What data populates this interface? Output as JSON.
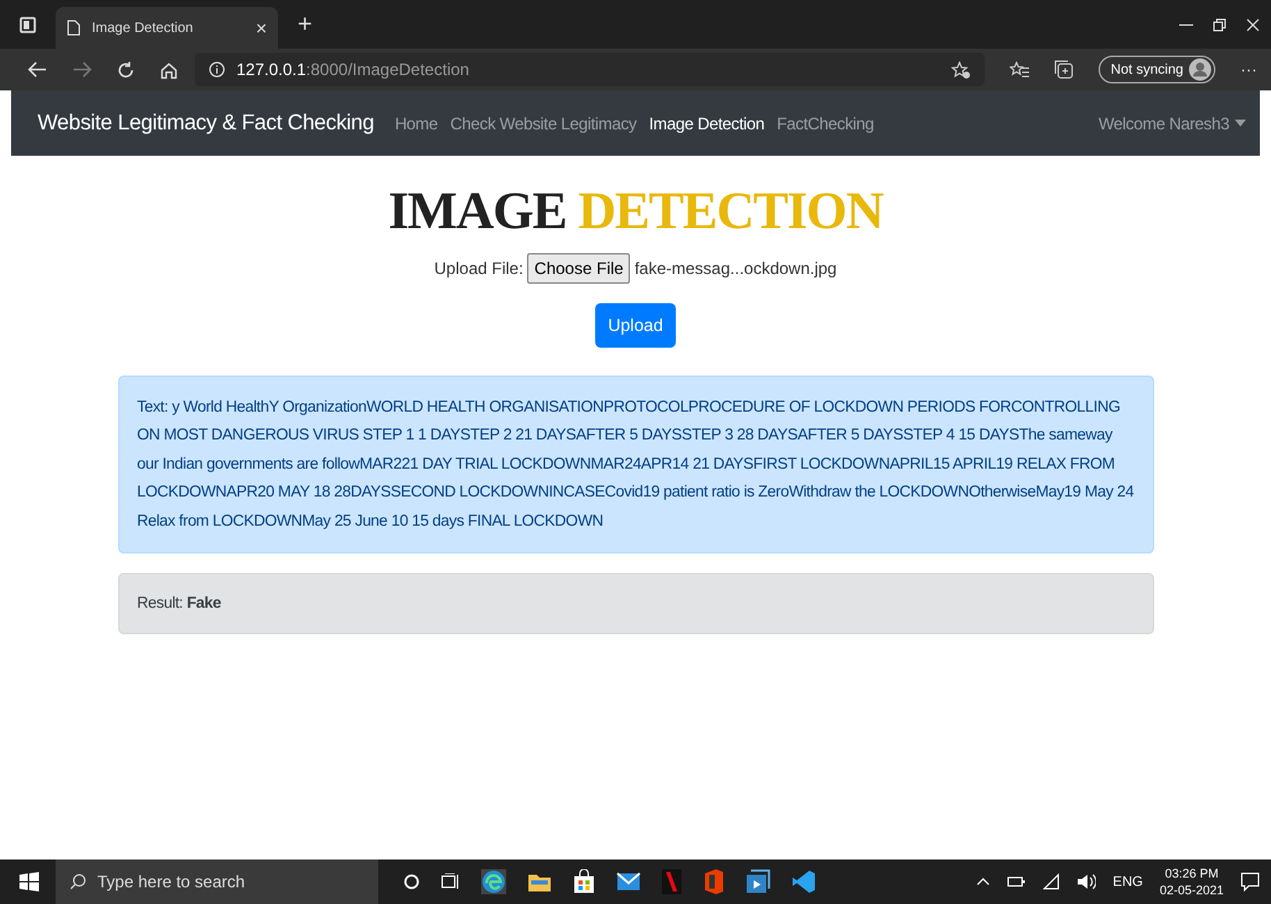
{
  "browser": {
    "tab_title": "Image Detection",
    "tab_close": "×",
    "new_tab": "+",
    "url_host": "127.0.0.1",
    "url_path": ":8000/ImageDetection",
    "sync_label": "Not syncing",
    "more": "···"
  },
  "navbar": {
    "brand": "Website Legitimacy & Fact Checking",
    "links": [
      {
        "label": "Home",
        "selected": false
      },
      {
        "label": "Check Website Legitimacy",
        "selected": false
      },
      {
        "label": "Image Detection",
        "selected": true
      },
      {
        "label": "FactChecking",
        "selected": false
      }
    ],
    "user_menu": "Welcome Naresh3"
  },
  "heading": {
    "part_1": "IMAGE",
    "part_2": "DETECTION"
  },
  "upload": {
    "label": "Upload File:",
    "choose_button": "Choose File",
    "file_name": "fake-messag...ockdown.jpg",
    "submit_button": "Upload"
  },
  "text_result": "Text: y World HealthY OrganizationWORLD HEALTH ORGANISATIONPROTOCOLPROCEDURE OF LOCKDOWN PERIODS FORCONTROLLING ON MOST DANGEROUS VIRUS STEP 1 1 DAYSTEP 2 21 DAYSAFTER 5 DAYSSTEP 3 28 DAYSAFTER 5 DAYSSTEP 4 15 DAYSThe sameway our Indian governments are followMAR221 DAY TRIAL LOCKDOWNMAR24APR14 21 DAYSFIRST LOCKDOWNAPRIL15 APRIL19 RELAX FROM LOCKDOWNAPR20 MAY 18 28DAYSSECOND LOCKDOWNINCASECovid19 patient ratio is ZeroWithdraw the LOCKDOWNOtherwiseMay19 May 24 Relax from LOCKDOWNMay 25 June 10 15 days FINAL LOCKDOWN",
  "verdict": "Result: **Fake**",
  "taskbar": {
    "search_placeholder": "Type here to search",
    "language": "ENG",
    "time": "03:26 PM",
    "date": "02-05-2021"
  }
}
